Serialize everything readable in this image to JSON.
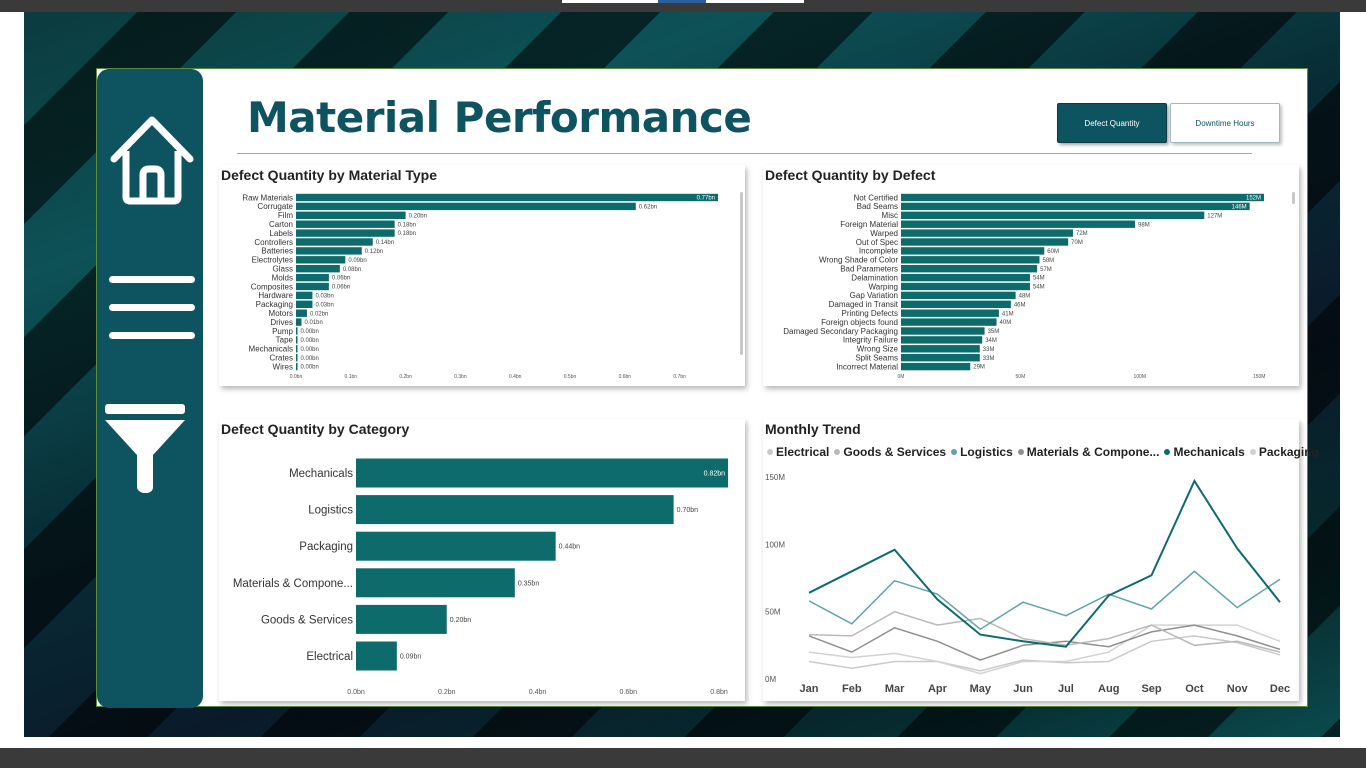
{
  "report": {
    "title": "Material Performance",
    "buttons": {
      "defect_quantity": "Defect Quantity",
      "downtime_hours": "Downtime Hours"
    }
  },
  "sidebar": {
    "icons": [
      "home-icon",
      "menu-icon",
      "filter-icon"
    ]
  },
  "colors": {
    "teal": "#0e6b6b",
    "dark_teal": "#0e5360",
    "sidebar": "#0e5360"
  },
  "charts": {
    "material_type": {
      "title": "Defect Quantity by Material Type",
      "chart_data": {
        "type": "bar",
        "orientation": "horizontal",
        "categories": [
          "Raw Materials",
          "Corrugate",
          "Film",
          "Carton",
          "Labels",
          "Controllers",
          "Batteries",
          "Electrolytes",
          "Glass",
          "Molds",
          "Composites",
          "Hardware",
          "Packaging",
          "Motors",
          "Drives",
          "Pump",
          "Tape",
          "Mechanicals",
          "Crates",
          "Wires"
        ],
        "values": [
          0.77,
          0.62,
          0.2,
          0.18,
          0.18,
          0.14,
          0.12,
          0.09,
          0.08,
          0.06,
          0.06,
          0.03,
          0.03,
          0.02,
          0.01,
          0.0,
          0.0,
          0.0,
          0.0,
          0.0
        ],
        "labels": [
          "0.77bn",
          "0.62bn",
          "0.20bn",
          "0.18bn",
          "0.18bn",
          "0.14bn",
          "0.12bn",
          "0.09bn",
          "0.08bn",
          "0.06bn",
          "0.06bn",
          "0.03bn",
          "0.03bn",
          "0.02bn",
          "0.01bn",
          "0.00bn",
          "0.00bn",
          "0.00bn",
          "0.00bn",
          "0.00bn"
        ],
        "xticks": [
          "0.0bn",
          "0.1bn",
          "0.2bn",
          "0.3bn",
          "0.4bn",
          "0.5bn",
          "0.6bn",
          "0.7bn"
        ],
        "xlim": [
          0,
          0.77
        ]
      }
    },
    "defect": {
      "title": "Defect Quantity by Defect",
      "chart_data": {
        "type": "bar",
        "orientation": "horizontal",
        "categories": [
          "Not Certified",
          "Bad Seams",
          "Misc",
          "Foreign Material",
          "Warped",
          "Out of Spec",
          "Incomplete",
          "Wrong Shade of Color",
          "Bad Parameters",
          "Delamination",
          "Warping",
          "Gap Variation",
          "Damaged in Transit",
          "Printing Defects",
          "Foreign objects found",
          "Damaged Secondary Packaging",
          "Integrity Failure",
          "Wrong Size",
          "Split Seams",
          "Incorrect Material"
        ],
        "values": [
          152,
          146,
          127,
          98,
          72,
          70,
          60,
          58,
          57,
          54,
          54,
          48,
          46,
          41,
          40,
          35,
          34,
          33,
          33,
          29
        ],
        "labels": [
          "152M",
          "146M",
          "127M",
          "98M",
          "72M",
          "70M",
          "60M",
          "58M",
          "57M",
          "54M",
          "54M",
          "48M",
          "46M",
          "41M",
          "40M",
          "35M",
          "34M",
          "33M",
          "33M",
          "29M"
        ],
        "xticks": [
          "0M",
          "50M",
          "100M",
          "150M"
        ],
        "xlim": [
          0,
          152
        ]
      }
    },
    "category": {
      "title": "Defect Quantity by Category",
      "chart_data": {
        "type": "bar",
        "orientation": "horizontal",
        "categories": [
          "Mechanicals",
          "Logistics",
          "Packaging",
          "Materials & Compone...",
          "Goods & Services",
          "Electrical"
        ],
        "values": [
          0.82,
          0.7,
          0.44,
          0.35,
          0.2,
          0.09
        ],
        "labels": [
          "0.82bn",
          "0.70bn",
          "0.44bn",
          "0.35bn",
          "0.20bn",
          "0.09bn"
        ],
        "xticks": [
          "0.0bn",
          "0.2bn",
          "0.4bn",
          "0.6bn",
          "0.8bn"
        ],
        "xlim": [
          0,
          0.8
        ]
      }
    },
    "trend": {
      "title": "Monthly Trend",
      "chart_data": {
        "type": "line",
        "x": [
          "Jan",
          "Feb",
          "Mar",
          "Apr",
          "May",
          "Jun",
          "Jul",
          "Aug",
          "Sep",
          "Oct",
          "Nov",
          "Dec"
        ],
        "yticks": [
          "0M",
          "50M",
          "100M",
          "150M"
        ],
        "ylim": [
          0,
          150
        ],
        "series": [
          {
            "name": "Electrical",
            "color": "#c9c9c9",
            "values": [
              13,
              8,
              13,
              13,
              6,
              14,
              12,
              13,
              28,
              32,
              27,
              18
            ]
          },
          {
            "name": "Goods & Services",
            "color": "#b9b9b9",
            "values": [
              33,
              32,
              50,
              40,
              45,
              30,
              25,
              30,
              40,
              25,
              28,
              20
            ]
          },
          {
            "name": "Logistics",
            "color": "#5fa4a8",
            "values": [
              58,
              41,
              73,
              63,
              37,
              57,
              47,
              63,
              52,
              80,
              53,
              74
            ]
          },
          {
            "name": "Materials & Compone...",
            "color": "#8f8f8f",
            "values": [
              32,
              20,
              38,
              28,
              14,
              25,
              28,
              24,
              35,
              40,
              32,
              22
            ]
          },
          {
            "name": "Mechanicals",
            "color": "#0e6b6b",
            "values": [
              64,
              80,
              96,
              59,
              33,
              28,
              24,
              62,
              77,
              147,
              97,
              57
            ]
          },
          {
            "name": "Packaging",
            "color": "#d2d2d2",
            "values": [
              20,
              16,
              19,
              13,
              4,
              13,
              13,
              20,
              40,
              40,
              40,
              28
            ]
          }
        ]
      }
    }
  }
}
